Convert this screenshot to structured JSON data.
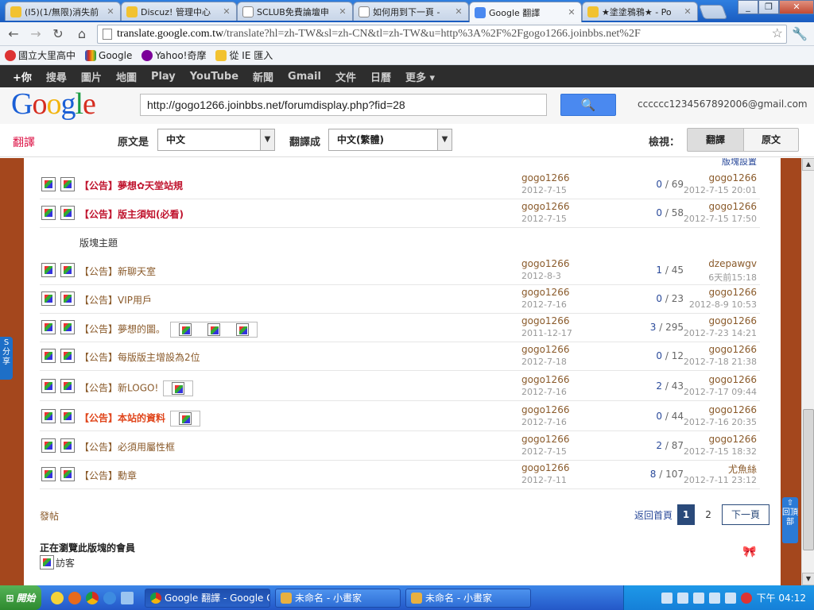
{
  "tabs": [
    {
      "title": "(I5)(1/無限)消失前",
      "color": "#f2c230"
    },
    {
      "title": "Discuz! 管理中心",
      "color": "#f2c230"
    },
    {
      "title": "SCLUB免費論壇申",
      "color": "#dfe8f4"
    },
    {
      "title": "如何用到下一頁 -",
      "color": "#dfe8f4"
    },
    {
      "title": "Google 翻譯",
      "color": "#4a89f0"
    },
    {
      "title": "★塗塗鴉鴉★ - Po",
      "color": "#f2c230"
    }
  ],
  "toolbar": {
    "url_host": "translate.google.com.tw",
    "url_path": "/translate?hl=zh-TW&sl=zh-CN&tl=zh-TW&u=http%3A%2F%2Fgogo1266.joinbbs.net%2F"
  },
  "bookmarks": [
    "國立大里高中",
    "Google",
    "Yahoo!奇摩",
    "從 IE 匯入"
  ],
  "gbar": [
    "+你",
    "搜尋",
    "圖片",
    "地圖",
    "Play",
    "YouTube",
    "新聞",
    "Gmail",
    "文件",
    "日曆",
    "更多 ▾"
  ],
  "google": {
    "logo": "Google",
    "search_value": "http://gogo1266.joinbbs.net/forumdisplay.php?fid=28",
    "email": "cccccc1234567892006@gmail.com"
  },
  "translate": {
    "label": "翻譯",
    "from_label": "原文是",
    "from_value": "中文",
    "to_label": "翻譯成",
    "to_value": "中文(繁體)",
    "view_label": "檢視：",
    "btn_translated": "翻譯",
    "btn_original": "原文"
  },
  "forum": {
    "top_link": "版塊設置",
    "section_label": "版塊主題",
    "pinned": [
      {
        "title": "【公告】夢想✿天堂站規",
        "author": "gogo1266",
        "date": "2012-7-15",
        "replies": "0",
        "views": "69",
        "last": "gogo1266",
        "lastdate": "2012-7-15 20:01"
      },
      {
        "title": "【公告】版主須知(必看)",
        "author": "gogo1266",
        "date": "2012-7-15",
        "replies": "0",
        "views": "58",
        "last": "gogo1266",
        "lastdate": "2012-7-15 17:50"
      }
    ],
    "threads": [
      {
        "title": "【公告】新聊天室",
        "author": "gogo1266",
        "date": "2012-8-3",
        "replies": "1",
        "views": "45",
        "last": "dzepawgv",
        "lastdate": "6天前15:18"
      },
      {
        "title": "【公告】VIP用戶",
        "author": "gogo1266",
        "date": "2012-7-16",
        "replies": "0",
        "views": "23",
        "last": "gogo1266",
        "lastdate": "2012-8-9 10:53"
      },
      {
        "title": "【公告】夢想的圖。",
        "author": "gogo1266",
        "date": "2011-12-17",
        "replies": "3",
        "views": "295",
        "last": "gogo1266",
        "lastdate": "2012-7-23 14:21"
      },
      {
        "title": "【公告】每版版主增設為2位",
        "author": "gogo1266",
        "date": "2012-7-18",
        "replies": "0",
        "views": "12",
        "last": "gogo1266",
        "lastdate": "2012-7-18 21:38"
      },
      {
        "title": "【公告】新LOGO!",
        "author": "gogo1266",
        "date": "2012-7-16",
        "replies": "2",
        "views": "43",
        "last": "gogo1266",
        "lastdate": "2012-7-17 09:44"
      },
      {
        "title": "【公告】本站的資料",
        "author": "gogo1266",
        "date": "2012-7-16",
        "replies": "0",
        "views": "44",
        "last": "gogo1266",
        "lastdate": "2012-7-16 20:35"
      },
      {
        "title": "【公告】必須用屬性框",
        "author": "gogo1266",
        "date": "2012-7-15",
        "replies": "2",
        "views": "87",
        "last": "gogo1266",
        "lastdate": "2012-7-15 18:32"
      },
      {
        "title": "【公告】勳章",
        "author": "gogo1266",
        "date": "2012-7-11",
        "replies": "8",
        "views": "107",
        "last": "尤魚絲",
        "lastdate": "2012-7-11 23:12"
      }
    ],
    "post_label": "發帖",
    "pager": {
      "back": "返回首頁",
      "current": "1",
      "page2": "2",
      "next": "下一頁"
    },
    "online_label": "正在瀏覽此版塊的會員",
    "guest_label": "訪客",
    "share_label": "分享",
    "backtop_label": "回頂部"
  },
  "taskbar": {
    "start": "開始",
    "tasks": [
      "Google 翻譯 - Google Ch...",
      "未命名 - 小畫家",
      "未命名 - 小畫家"
    ],
    "clock": "下午 04:12"
  }
}
